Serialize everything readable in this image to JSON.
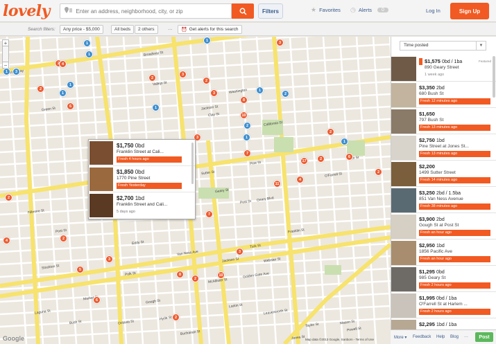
{
  "header": {
    "logo": "lovely",
    "search_placeholder": "Enter an address, neighborhood, city, or zip",
    "filters_label": "Filters",
    "favorites_label": "Favorites",
    "alerts_label": "Alerts",
    "alerts_count": "0",
    "login_label": "Log In",
    "signup_label": "Sign Up"
  },
  "filterbar": {
    "label": "Search filters:",
    "price": "Any price - $5,000",
    "beds": "All beds",
    "others": "2 others",
    "more": "···",
    "alert_btn": "Get alerts for this search"
  },
  "map": {
    "zoom_in": "+",
    "zoom_out": "−",
    "google": "Google",
    "attribution": "Map data ©2013 Google, Sanborn - Terms of Use",
    "streets": [
      "Broadway",
      "Broadway St",
      "Vallejo St",
      "Green St",
      "Jackson St",
      "Washington",
      "Clay St",
      "Sacramento St",
      "California St",
      "Pine St",
      "Bush St",
      "Sutter St",
      "Post St",
      "Geary Blvd",
      "O'Farrell St",
      "Ellis St",
      "Eddy St",
      "Turk St",
      "Golden Gate Ave",
      "McAllister St",
      "Polk St",
      "Van Ness Ave",
      "Franklin St",
      "Gough St",
      "Octavia St",
      "Hyde St",
      "Larkin St",
      "Leavenworth St",
      "Jones St",
      "Taylor St",
      "Mason St",
      "Powell St",
      "Stockton St",
      "Market St",
      "Bush St",
      "Post St",
      "Geary St",
      "Jackson St",
      "Laguna St",
      "Buchanan St",
      "Webster St",
      "Fillmore St"
    ],
    "markers": [
      {
        "n": "1",
        "c": "b"
      },
      {
        "n": "2",
        "c": "o"
      },
      {
        "n": "4",
        "c": "o"
      },
      {
        "n": "1",
        "c": "b"
      },
      {
        "n": "3",
        "c": "b"
      },
      {
        "n": "1",
        "c": "b"
      },
      {
        "n": "2",
        "c": "o"
      },
      {
        "n": "1",
        "c": "b"
      },
      {
        "n": "1",
        "c": "b"
      },
      {
        "n": "2",
        "c": "o"
      },
      {
        "n": "8",
        "c": "o"
      },
      {
        "n": "2",
        "c": "b"
      },
      {
        "n": "3",
        "c": "o"
      },
      {
        "n": "1",
        "c": "b"
      },
      {
        "n": "1",
        "c": "b"
      },
      {
        "n": "3",
        "c": "o"
      },
      {
        "n": "2",
        "c": "b"
      },
      {
        "n": "10",
        "c": "o"
      },
      {
        "n": "3",
        "c": "o"
      },
      {
        "n": "1",
        "c": "b"
      },
      {
        "n": "2",
        "c": "o"
      },
      {
        "n": "1",
        "c": "b"
      },
      {
        "n": "6",
        "c": "o"
      },
      {
        "n": "7",
        "c": "o"
      },
      {
        "n": "17",
        "c": "o"
      },
      {
        "n": "2",
        "c": "o"
      },
      {
        "n": "11",
        "c": "o"
      },
      {
        "n": "2",
        "c": "o"
      },
      {
        "n": "4",
        "c": "o"
      },
      {
        "n": "6",
        "c": "o"
      },
      {
        "n": "3",
        "c": "o"
      },
      {
        "n": "1",
        "c": "b"
      },
      {
        "n": "2",
        "c": "o"
      },
      {
        "n": "7",
        "c": "o"
      },
      {
        "n": "8",
        "c": "o"
      },
      {
        "n": "3",
        "c": "o"
      },
      {
        "n": "10",
        "c": "o"
      },
      {
        "n": "2",
        "c": "o"
      },
      {
        "n": "2",
        "c": "o"
      },
      {
        "n": "5",
        "c": "o"
      },
      {
        "n": "2",
        "c": "o"
      },
      {
        "n": "3",
        "c": "o"
      },
      {
        "n": "6",
        "c": "o"
      },
      {
        "n": "4",
        "c": "o"
      },
      {
        "n": "2",
        "c": "o"
      }
    ]
  },
  "popup": [
    {
      "price": "$1,750",
      "beds": "0bd",
      "address": "Franklin Street at Cali...",
      "fresh": "Fresh",
      "ago": "4 hours ago",
      "is_fresh": true
    },
    {
      "price": "$1,850",
      "beds": "0bd",
      "address": "1770 Pine Street",
      "fresh": "Fresh",
      "ago": "Yesterday",
      "is_fresh": true
    },
    {
      "price": "$2,700",
      "beds": "1bd",
      "address": "Franklin Street and Cali...",
      "fresh": "",
      "ago": "5 days ago",
      "is_fresh": false
    }
  ],
  "sidebar": {
    "sort_label": "Time posted",
    "sort_arrow": "▼",
    "listings": [
      {
        "price": "$1,575",
        "beds": "0bd / 1ba",
        "address": "890 Geary Street",
        "fresh": "",
        "ago": "1 week ago",
        "is_fresh": false,
        "featured": "Featured",
        "thumb": "#6f5a48"
      },
      {
        "price": "$3,350",
        "beds": "2bd",
        "address": "680 Bush St",
        "fresh": "Fresh",
        "ago": "12 minutes ago",
        "is_fresh": true,
        "featured": "",
        "thumb": "#c2b49e"
      },
      {
        "price": "$1,650",
        "beds": "",
        "address": "797 Bush St",
        "fresh": "Fresh",
        "ago": "13 minutes ago",
        "is_fresh": true,
        "featured": "",
        "thumb": "#8a7a68"
      },
      {
        "price": "$2,750",
        "beds": "1bd",
        "address": "Pine Street at Jones St...",
        "fresh": "Fresh",
        "ago": "13 minutes ago",
        "is_fresh": true,
        "featured": "",
        "thumb": "#d8d4cc"
      },
      {
        "price": "$2,200",
        "beds": "",
        "address": "1499 Sutter Street",
        "fresh": "Fresh",
        "ago": "14 minutes ago",
        "is_fresh": true,
        "featured": "",
        "thumb": "#7b5e3c"
      },
      {
        "price": "$3,250",
        "beds": "2bd / 1.5ba",
        "address": "851 Van Ness Avenue",
        "fresh": "Fresh",
        "ago": "38 minutes ago",
        "is_fresh": true,
        "featured": "",
        "thumb": "#5a6a72"
      },
      {
        "price": "$3,900",
        "beds": "2bd",
        "address": "Gough St at Post St",
        "fresh": "Fresh",
        "ago": "an hour ago",
        "is_fresh": true,
        "featured": "",
        "thumb": "#d6cfc4"
      },
      {
        "price": "$2,950",
        "beds": "1bd",
        "address": "1856 Pacific Ave",
        "fresh": "Fresh",
        "ago": "an hour ago",
        "is_fresh": true,
        "featured": "",
        "thumb": "#a88e6e"
      },
      {
        "price": "$1,295",
        "beds": "0bd",
        "address": "985 Geary St",
        "fresh": "Fresh",
        "ago": "2 hours ago",
        "is_fresh": true,
        "featured": "",
        "thumb": "#6e6a66"
      },
      {
        "price": "$1,995",
        "beds": "0bd / 1ba",
        "address": "O'Farrell St at Harlem ...",
        "fresh": "Fresh",
        "ago": "2 hours ago",
        "is_fresh": true,
        "featured": "",
        "thumb": "#c9c3bb"
      },
      {
        "price": "$2,295",
        "beds": "1bd / 1ba",
        "address": "",
        "fresh": "",
        "ago": "",
        "is_fresh": false,
        "featured": "",
        "thumb": "#b7a894"
      }
    ]
  },
  "footer": {
    "more": "More ▾",
    "feedback": "Feedback",
    "help": "Help",
    "blog": "Blog",
    "dots": "···",
    "post": "Post"
  },
  "colors": {
    "brand": "#f15a22",
    "marker_orange": "#ef5b2f",
    "marker_blue": "#3e8fd0",
    "major_road": "#f7e36d",
    "post_button": "#5cb85c"
  }
}
